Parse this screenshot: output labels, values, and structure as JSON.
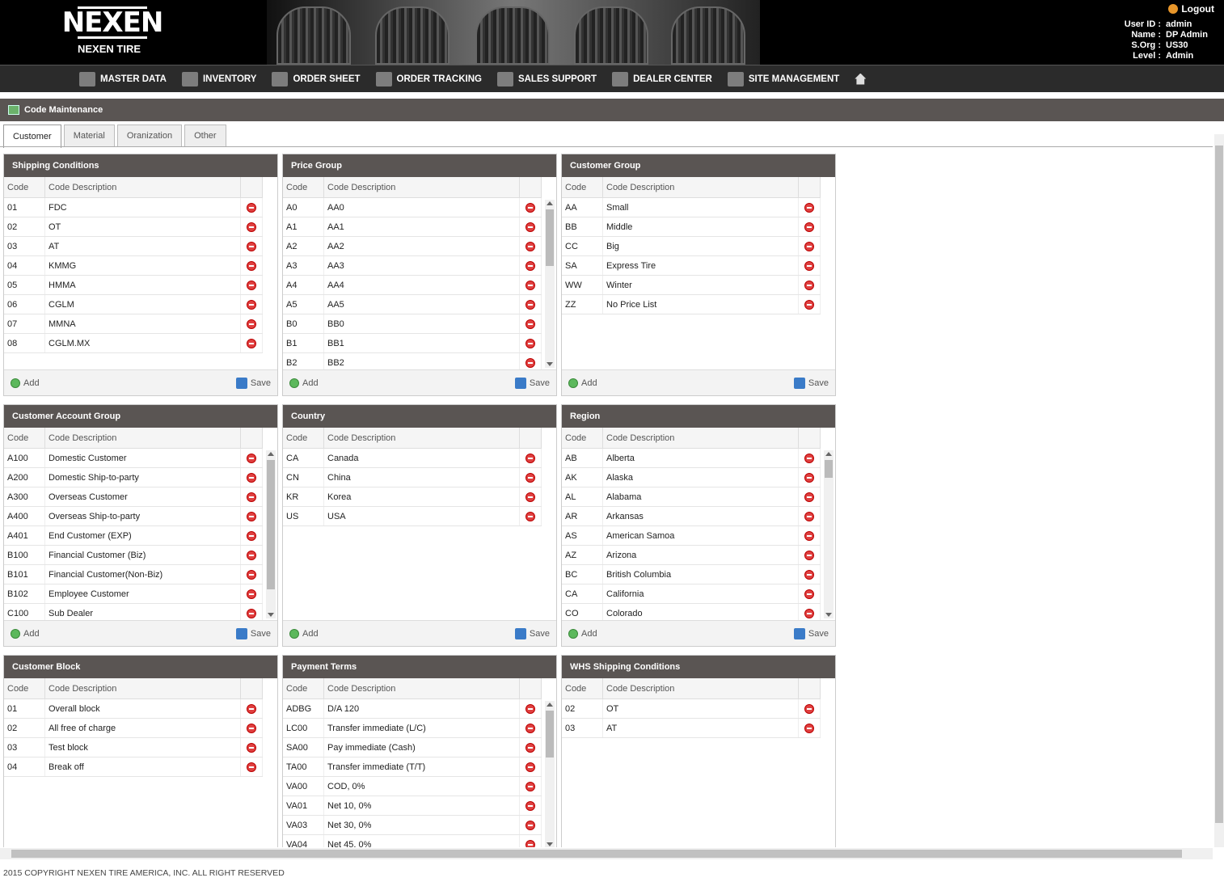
{
  "header": {
    "brand_mark": "NEXEN",
    "brand_name": "NEXEN TIRE",
    "logout_label": "Logout",
    "user": [
      {
        "label": "User ID :",
        "value": "admin"
      },
      {
        "label": "Name :",
        "value": "DP Admin"
      },
      {
        "label": "S.Org :",
        "value": "US30"
      },
      {
        "label": "Level :",
        "value": "Admin"
      }
    ]
  },
  "nav": [
    {
      "label": "MASTER DATA",
      "icon": "master-data-icon"
    },
    {
      "label": "INVENTORY",
      "icon": "inventory-icon"
    },
    {
      "label": "ORDER SHEET",
      "icon": "order-sheet-icon"
    },
    {
      "label": "ORDER TRACKING",
      "icon": "order-tracking-icon"
    },
    {
      "label": "SALES SUPPORT",
      "icon": "sales-support-icon"
    },
    {
      "label": "DEALER CENTER",
      "icon": "dealer-center-icon"
    },
    {
      "label": "SITE MANAGEMENT",
      "icon": "site-management-icon"
    }
  ],
  "page_title": "Code Maintenance",
  "tabs": [
    "Customer",
    "Material",
    "Oranization",
    "Other"
  ],
  "active_tab": "Customer",
  "col_code": "Code",
  "col_desc": "Code Description",
  "add_label": "Add",
  "save_label": "Save",
  "panels": [
    {
      "title": "Shipping Conditions",
      "rows": [
        [
          "01",
          "FDC"
        ],
        [
          "02",
          "OT"
        ],
        [
          "03",
          "AT"
        ],
        [
          "04",
          "KMMG"
        ],
        [
          "05",
          "HMMA"
        ],
        [
          "06",
          "CGLM"
        ],
        [
          "07",
          "MMNA"
        ],
        [
          "08",
          "CGLM.MX"
        ]
      ],
      "scroll": false
    },
    {
      "title": "Price Group",
      "rows": [
        [
          "A0",
          "AA0"
        ],
        [
          "A1",
          "AA1"
        ],
        [
          "A2",
          "AA2"
        ],
        [
          "A3",
          "AA3"
        ],
        [
          "A4",
          "AA4"
        ],
        [
          "A5",
          "AA5"
        ],
        [
          "B0",
          "BB0"
        ],
        [
          "B1",
          "BB1"
        ],
        [
          "B2",
          "BB2"
        ]
      ],
      "scroll": true
    },
    {
      "title": "Customer Group",
      "rows": [
        [
          "AA",
          "Small"
        ],
        [
          "BB",
          "Middle"
        ],
        [
          "CC",
          "Big"
        ],
        [
          "SA",
          "Express Tire"
        ],
        [
          "WW",
          "Winter"
        ],
        [
          "ZZ",
          "No Price List"
        ]
      ],
      "scroll": false
    },
    {
      "title": "Customer Account Group",
      "rows": [
        [
          "A100",
          "Domestic Customer"
        ],
        [
          "A200",
          "Domestic Ship-to-party"
        ],
        [
          "A300",
          "Overseas Customer"
        ],
        [
          "A400",
          "Overseas Ship-to-party"
        ],
        [
          "A401",
          "End Customer (EXP)"
        ],
        [
          "B100",
          "Financial Customer (Biz)"
        ],
        [
          "B101",
          "Financial Customer(Non-Biz)"
        ],
        [
          "B102",
          "Employee Customer"
        ],
        [
          "C100",
          "Sub Dealer"
        ]
      ],
      "scroll": true
    },
    {
      "title": "Country",
      "rows": [
        [
          "CA",
          "Canada"
        ],
        [
          "CN",
          "China"
        ],
        [
          "KR",
          "Korea"
        ],
        [
          "US",
          "USA"
        ]
      ],
      "scroll": false
    },
    {
      "title": "Region",
      "rows": [
        [
          "AB",
          "Alberta"
        ],
        [
          "AK",
          "Alaska"
        ],
        [
          "AL",
          "Alabama"
        ],
        [
          "AR",
          "Arkansas"
        ],
        [
          "AS",
          "American Samoa"
        ],
        [
          "AZ",
          "Arizona"
        ],
        [
          "BC",
          "British Columbia"
        ],
        [
          "CA",
          "California"
        ],
        [
          "CO",
          "Colorado"
        ]
      ],
      "scroll": true
    },
    {
      "title": "Customer Block",
      "rows": [
        [
          "01",
          "Overall block"
        ],
        [
          "02",
          "All free of charge"
        ],
        [
          "03",
          "Test block"
        ],
        [
          "04",
          "Break off"
        ]
      ],
      "scroll": false
    },
    {
      "title": "Payment Terms",
      "rows": [
        [
          "ADBG",
          "D/A 120"
        ],
        [
          "LC00",
          "Transfer immediate (L/C)"
        ],
        [
          "SA00",
          "Pay immediate (Cash)"
        ],
        [
          "TA00",
          "Transfer immediate (T/T)"
        ],
        [
          "VA00",
          "COD, 0%"
        ],
        [
          "VA01",
          "Net 10, 0%"
        ],
        [
          "VA03",
          "Net 30, 0%"
        ],
        [
          "VA04",
          "Net 45, 0%"
        ]
      ],
      "scroll": true
    },
    {
      "title": "WHS Shipping Conditions",
      "rows": [
        [
          "02",
          "OT"
        ],
        [
          "03",
          "AT"
        ]
      ],
      "scroll": false
    }
  ],
  "footer": "2015 COPYRIGHT NEXEN TIRE AMERICA, INC. ALL RIGHT RESERVED"
}
